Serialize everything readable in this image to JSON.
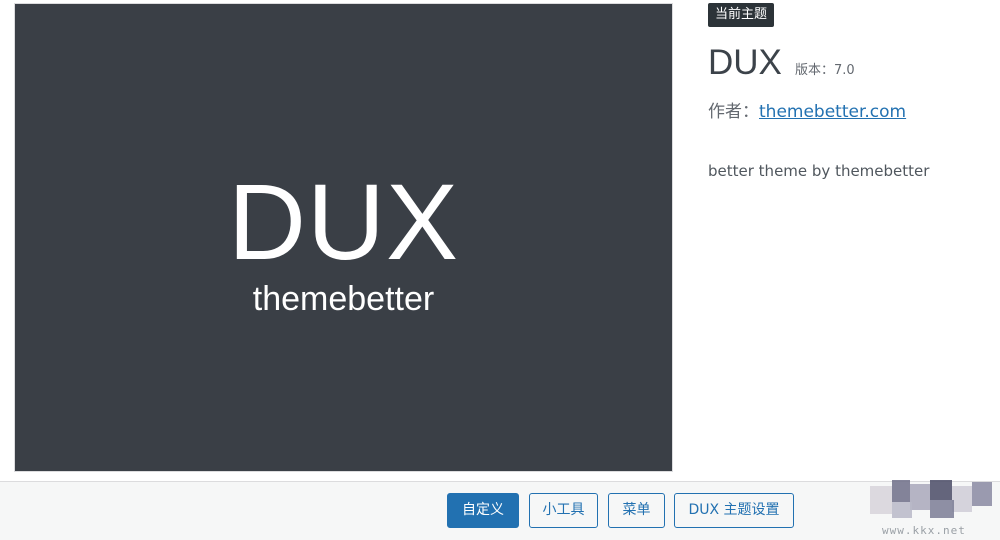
{
  "theme": {
    "badge": "当前主题",
    "name": "DUX",
    "version": "版本：7.0",
    "author_label": "作者：",
    "author_link": "themebetter.com",
    "description": "better theme by themebetter"
  },
  "screenshot": {
    "logo_main": "DUX",
    "logo_sub": "themebetter"
  },
  "actions": {
    "customize": "自定义",
    "widgets": "小工具",
    "menus": "菜单",
    "theme_settings": "DUX 主题设置"
  },
  "watermark": {
    "text": "www.kkx.net"
  },
  "colors": {
    "accent": "#2271b1",
    "screenshot_bg": "#3a3f46",
    "badge_bg": "#2c3338"
  }
}
